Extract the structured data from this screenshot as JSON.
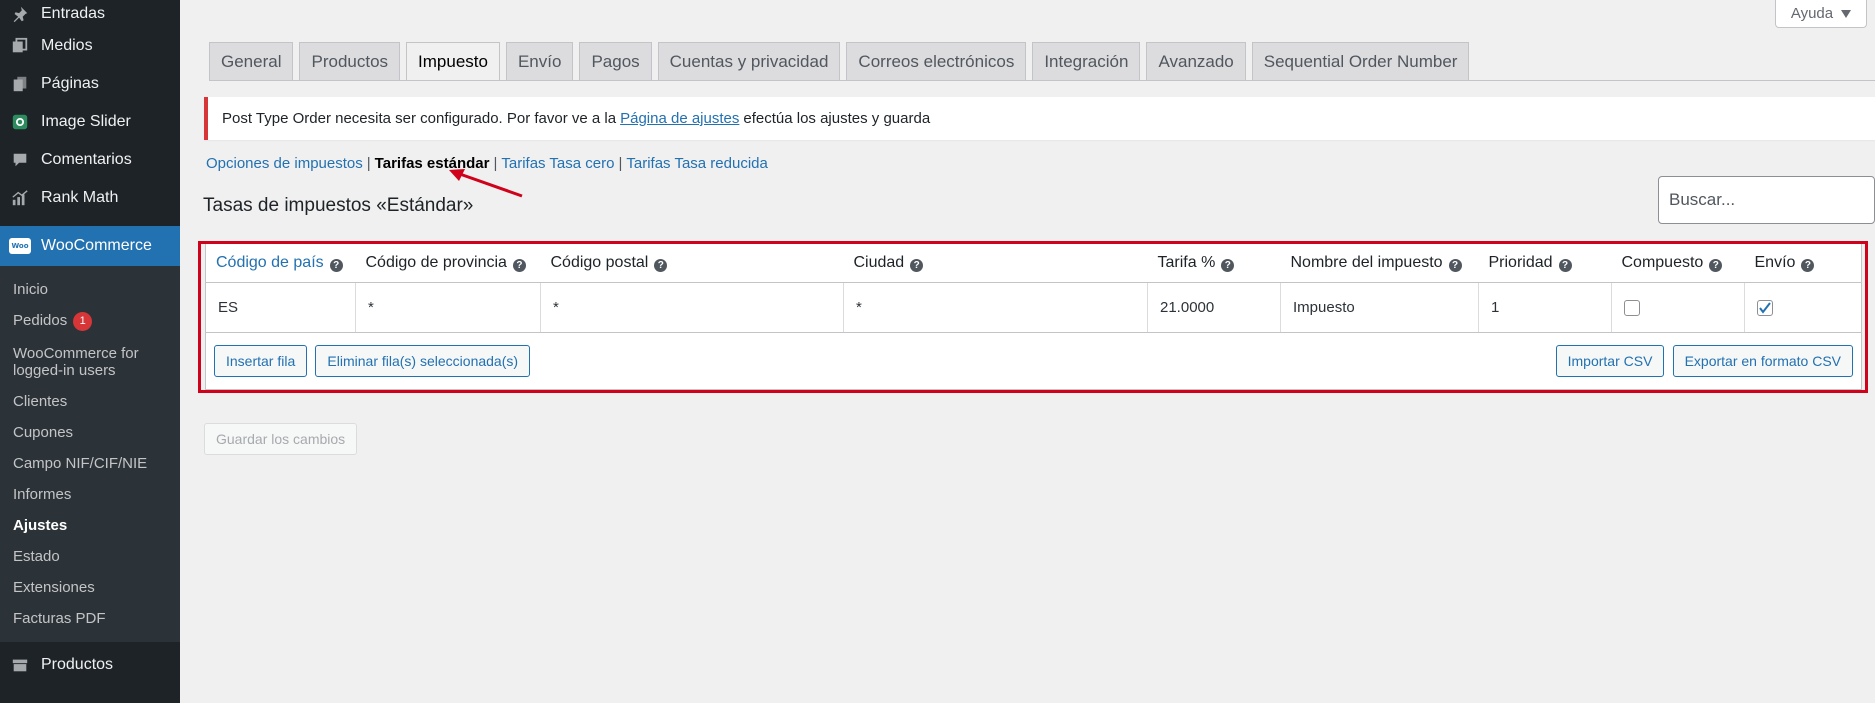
{
  "sidebar": {
    "top_items": [
      {
        "label": "Entradas",
        "icon": "pin-icon"
      },
      {
        "label": "Medios",
        "icon": "media-icon"
      },
      {
        "label": "Páginas",
        "icon": "pages-icon"
      },
      {
        "label": "Image Slider",
        "icon": "slider-icon"
      },
      {
        "label": "Comentarios",
        "icon": "comments-icon"
      },
      {
        "label": "Rank Math",
        "icon": "rank-math-icon"
      }
    ],
    "woocommerce_label": "WooCommerce",
    "woo_logo_text": "Woo",
    "submenu": [
      {
        "label": "Inicio"
      },
      {
        "label": "Pedidos",
        "badge": "1"
      },
      {
        "label": "WooCommerce for logged-in users"
      },
      {
        "label": "Clientes"
      },
      {
        "label": "Cupones"
      },
      {
        "label": "Campo NIF/CIF/NIE"
      },
      {
        "label": "Informes"
      },
      {
        "label": "Ajustes"
      },
      {
        "label": "Estado"
      },
      {
        "label": "Extensiones"
      },
      {
        "label": "Facturas PDF"
      }
    ],
    "products_label": "Productos"
  },
  "help": {
    "label": "Ayuda"
  },
  "tabs": [
    "General",
    "Productos",
    "Impuesto",
    "Envío",
    "Pagos",
    "Cuentas y privacidad",
    "Correos electrónicos",
    "Integración",
    "Avanzado",
    "Sequential Order Number"
  ],
  "active_tab": "Impuesto",
  "notice": {
    "before": "Post Type Order necesita ser configurado. Por favor ve a la",
    "link": "Página de ajustes",
    "after": "efectúa los ajustes y guarda"
  },
  "subnav": {
    "options": "Opciones de impuestos",
    "standard": "Tarifas estándar",
    "zero": "Tarifas Tasa cero",
    "reduced": "Tarifas Tasa reducida",
    "separator": "|"
  },
  "heading": "Tasas de impuestos «Estándar»",
  "search": {
    "placeholder": "Buscar..."
  },
  "table": {
    "columns": [
      "Código de país",
      "Código de provincia",
      "Código postal",
      "Ciudad",
      "Tarifa %",
      "Nombre del impuesto",
      "Prioridad",
      "Compuesto",
      "Envío"
    ],
    "rows": [
      {
        "country": "ES",
        "state": "*",
        "postcode": "*",
        "city": "*",
        "rate": "21.0000",
        "name": "Impuesto",
        "priority": "1",
        "compound": false,
        "shipping": true
      }
    ],
    "help_glyph": "?"
  },
  "buttons": {
    "insert": "Insertar fila",
    "remove": "Eliminar fila(s) seleccionada(s)",
    "import": "Importar CSV",
    "export": "Exportar en formato CSV",
    "save": "Guardar los cambios"
  },
  "colors": {
    "accent": "#2271b1",
    "highlight": "#d0021b",
    "notice_error": "#d63638"
  }
}
